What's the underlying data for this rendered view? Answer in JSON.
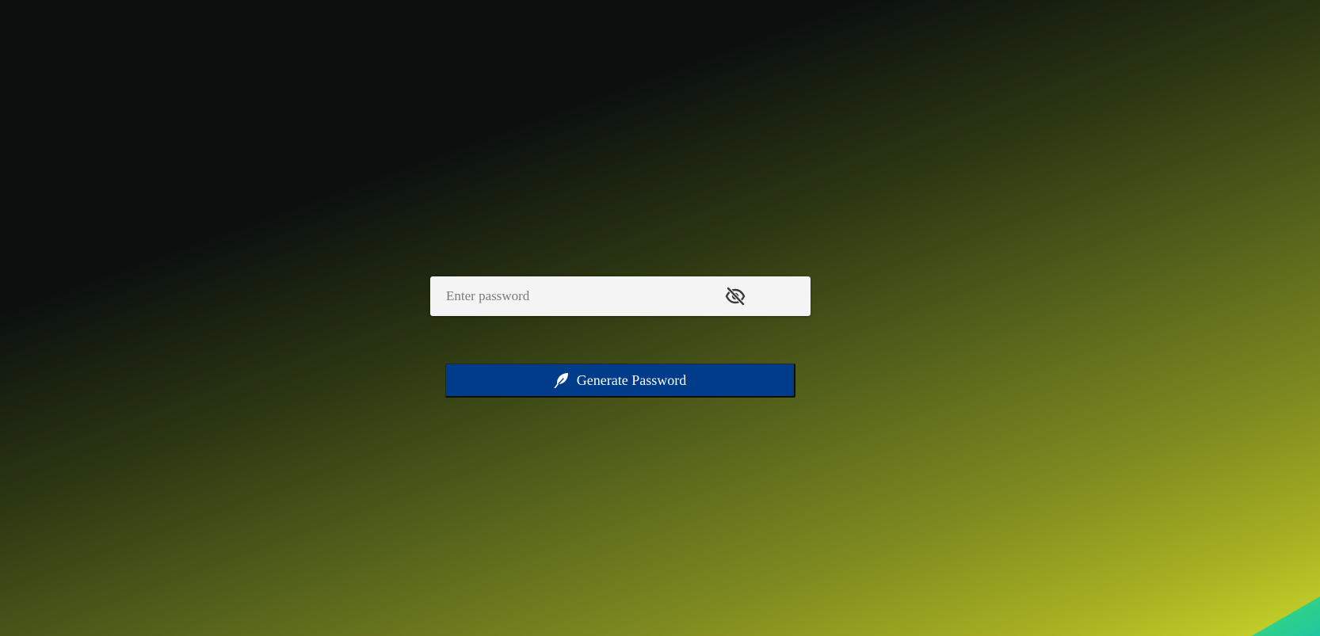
{
  "password_field": {
    "placeholder": "Enter password",
    "value": "",
    "toggle_icon": "eye-slash-icon"
  },
  "generate_button": {
    "label": "Generate Password",
    "icon": "feather-icon",
    "background_color": "#003c8a"
  },
  "theme": {
    "gradient_start": "#0b100f",
    "gradient_end": "#c8d52a"
  }
}
